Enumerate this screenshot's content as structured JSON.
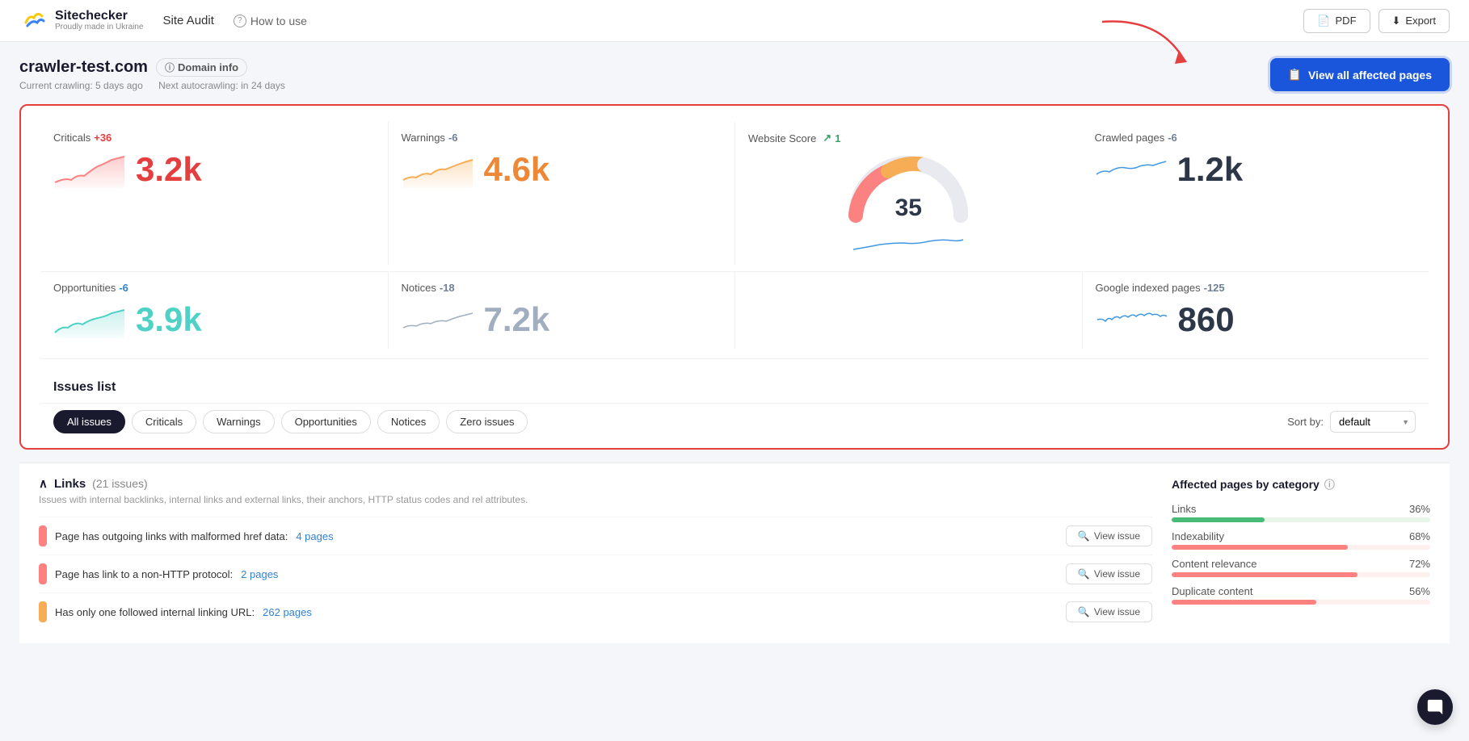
{
  "header": {
    "logo_title": "Sitechecker",
    "logo_sub": "Proudly made in Ukraine",
    "nav_audit": "Site Audit",
    "nav_how_to_use": "How to use",
    "btn_pdf": "PDF",
    "btn_export": "Export"
  },
  "site": {
    "domain": "crawler-test.com",
    "domain_info_label": "Domain info",
    "crawling_status": "Current crawling: 5 days ago",
    "next_crawl": "Next autocrawling: in 24 days",
    "btn_view_affected": "View all affected pages"
  },
  "stats": {
    "criticals_label": "Criticals",
    "criticals_change": "+36",
    "criticals_value": "3.2k",
    "warnings_label": "Warnings",
    "warnings_change": "-6",
    "warnings_value": "4.6k",
    "opportunities_label": "Opportunities",
    "opportunities_change": "-6",
    "opportunities_value": "3.9k",
    "notices_label": "Notices",
    "notices_change": "-18",
    "notices_value": "7.2k",
    "website_score_label": "Website Score",
    "website_score_change": "1",
    "website_score_value": "35",
    "crawled_pages_label": "Crawled pages",
    "crawled_pages_change": "-6",
    "crawled_pages_value": "1.2k",
    "google_indexed_label": "Google indexed pages",
    "google_indexed_change": "-125",
    "google_indexed_value": "860"
  },
  "issues_list": {
    "title": "Issues list",
    "filters": [
      "All issues",
      "Criticals",
      "Warnings",
      "Opportunities",
      "Notices",
      "Zero issues"
    ],
    "active_filter": "All issues",
    "sort_label": "Sort by:",
    "sort_value": "default"
  },
  "links_section": {
    "title": "Links",
    "issues_count": "(21 issues)",
    "description": "Issues with internal backlinks, internal links and external links, their anchors, HTTP status codes and rel attributes.",
    "issues": [
      {
        "type": "red",
        "text": "Page has outgoing links with malformed href data:",
        "pages": "4 pages",
        "btn": "View issue"
      },
      {
        "type": "red",
        "text": "Page has link to a non-HTTP protocol:",
        "pages": "2 pages",
        "btn": "View issue"
      },
      {
        "type": "orange",
        "text": "Has only one followed internal linking URL:",
        "pages": "262 pages",
        "btn": "View issue"
      }
    ]
  },
  "affected_pages": {
    "title": "Affected pages by category",
    "categories": [
      {
        "label": "Links",
        "pct": 36,
        "pct_label": "36%",
        "type": "mixed"
      },
      {
        "label": "Indexability",
        "pct": 68,
        "pct_label": "68%",
        "type": "red"
      },
      {
        "label": "Content relevance",
        "pct": 72,
        "pct_label": "72%",
        "type": "red"
      },
      {
        "label": "Duplicate content",
        "pct": 56,
        "pct_label": "56%",
        "type": "red"
      }
    ]
  }
}
